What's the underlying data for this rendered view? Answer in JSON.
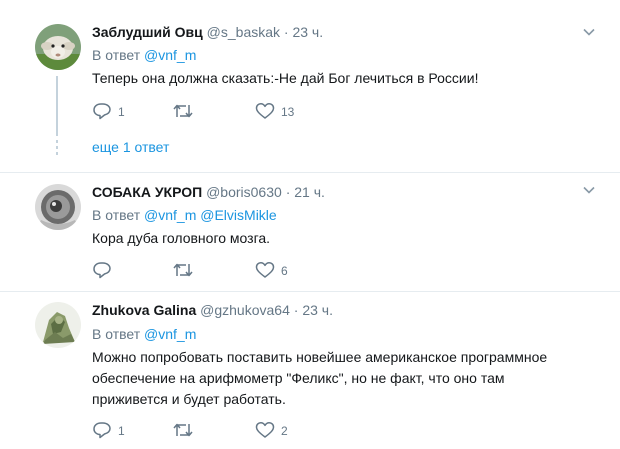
{
  "tweets": [
    {
      "name": "Заблудший Овц",
      "handle": "@s_baskak",
      "time": "23 ч.",
      "reply_prefix": "В ответ",
      "mentions": "@vnf_m",
      "text": "Теперь она должна сказать:-Не дай Бог лечиться в России!",
      "replies": "1",
      "retweets": "",
      "likes": "13",
      "more_replies": "еще 1 ответ"
    },
    {
      "name": "СОБАКА УКРОП",
      "handle": "@boris0630",
      "time": "21 ч.",
      "reply_prefix": "В ответ",
      "mentions": "@vnf_m @ElvisMikle",
      "text": "Кора дуба головного мозга.",
      "replies": "",
      "retweets": "",
      "likes": "6"
    },
    {
      "name": "Zhukova Galina",
      "handle": "@gzhukova64",
      "time": "23 ч.",
      "reply_prefix": "В ответ",
      "mentions": "@vnf_m",
      "text_lines": [
        "Можно попробовать поставить новейшее американское программное",
        "обеспечение на арифмометр \"Феликс\", но не факт, что оно там",
        "приживется и будет работать."
      ],
      "replies": "1",
      "retweets": "",
      "likes": "2"
    }
  ],
  "separator": "·",
  "icons": {
    "reply": "reply-icon",
    "retweet": "retweet-icon",
    "like": "heart-icon",
    "menu": "chevron-down-icon"
  },
  "colors": {
    "link": "#1b95e0",
    "muted": "#657786",
    "text": "#14171a",
    "divider": "#e6ecf0",
    "thread_line": "#c4d2dc"
  }
}
